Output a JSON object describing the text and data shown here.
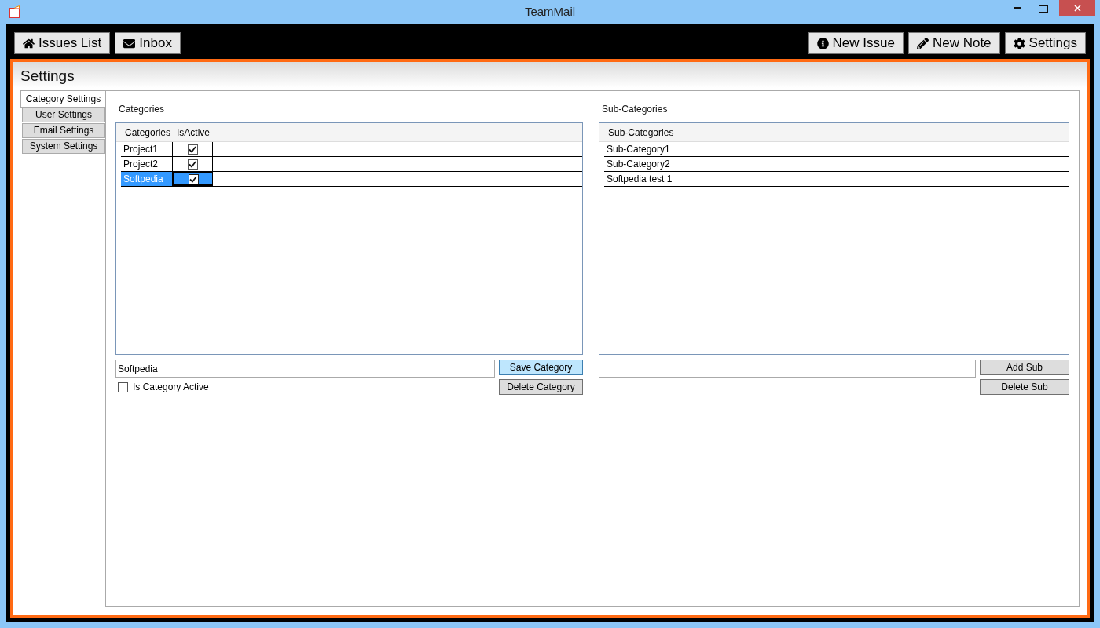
{
  "window": {
    "title": "TeamMail"
  },
  "toolbar": {
    "left": [
      {
        "label": "Issues List",
        "kind": "home"
      },
      {
        "label": "Inbox",
        "kind": "mail"
      }
    ],
    "right": [
      {
        "label": "New Issue",
        "kind": "info"
      },
      {
        "label": "New Note",
        "kind": "pencil"
      },
      {
        "label": "Settings",
        "kind": "gear"
      }
    ]
  },
  "page_title": "Settings",
  "tabs": [
    {
      "label": "Category Settings",
      "selected": true
    },
    {
      "label": "User Settings",
      "selected": false
    },
    {
      "label": "Email Settings",
      "selected": false
    },
    {
      "label": "System Settings",
      "selected": false
    }
  ],
  "categories": {
    "label": "Categories",
    "columns": [
      "Categories",
      "IsActive"
    ],
    "rows": [
      {
        "name": "Project1",
        "active": true,
        "selected": false
      },
      {
        "name": "Project2",
        "active": true,
        "selected": false
      },
      {
        "name": "Softpedia",
        "active": true,
        "selected": true
      }
    ],
    "input_value": "Softpedia",
    "save_button": "Save Category",
    "delete_button": "Delete Category",
    "active_checkbox": {
      "label": "Is Category Active",
      "checked": false
    }
  },
  "subcategories": {
    "label": "Sub-Categories",
    "columns": [
      "Sub-Categories"
    ],
    "rows": [
      {
        "name": "Sub-Category1",
        "selected": false
      },
      {
        "name": "Sub-Category2",
        "selected": false
      },
      {
        "name": "Softpedia test 1",
        "selected": false
      }
    ],
    "add_button": "Add Sub",
    "delete_button": "Delete Sub"
  }
}
